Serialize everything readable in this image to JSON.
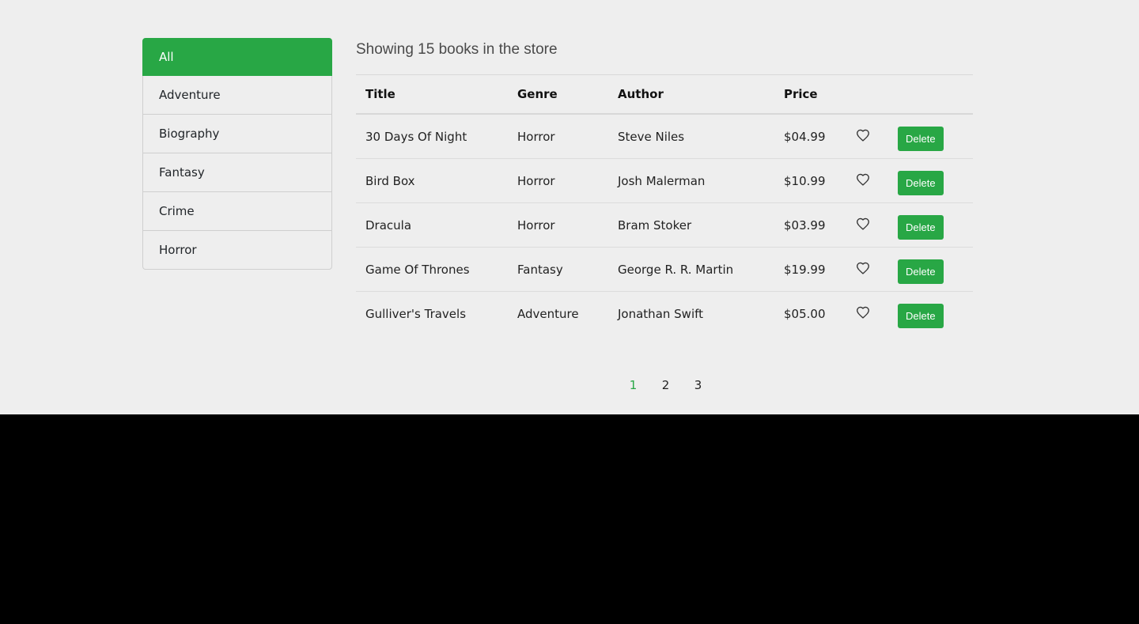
{
  "sidebar": {
    "items": [
      {
        "label": "All",
        "active": true
      },
      {
        "label": "Adventure",
        "active": false
      },
      {
        "label": "Biography",
        "active": false
      },
      {
        "label": "Fantasy",
        "active": false
      },
      {
        "label": "Crime",
        "active": false
      },
      {
        "label": "Horror",
        "active": false
      }
    ]
  },
  "main": {
    "summary": "Showing 15 books in the store",
    "table": {
      "headers": [
        "Title",
        "Genre",
        "Author",
        "Price"
      ],
      "rows": [
        {
          "title": "30 Days Of Night",
          "genre": "Horror",
          "author": "Steve Niles",
          "price": "$04.99",
          "action": "Delete"
        },
        {
          "title": "Bird Box",
          "genre": "Horror",
          "author": "Josh Malerman",
          "price": "$10.99",
          "action": "Delete"
        },
        {
          "title": "Dracula",
          "genre": "Horror",
          "author": "Bram Stoker",
          "price": "$03.99",
          "action": "Delete"
        },
        {
          "title": "Game Of Thrones",
          "genre": "Fantasy",
          "author": "George R. R. Martin",
          "price": "$19.99",
          "action": "Delete"
        },
        {
          "title": "Gulliver's Travels",
          "genre": "Adventure",
          "author": "Jonathan Swift",
          "price": "$05.00",
          "action": "Delete"
        }
      ]
    },
    "pagination": {
      "pages": [
        "1",
        "2",
        "3"
      ],
      "current": "1"
    }
  },
  "icons": {
    "like": "heart-outline-icon"
  },
  "colors": {
    "accent": "#28a745",
    "background": "#eeeeee"
  }
}
